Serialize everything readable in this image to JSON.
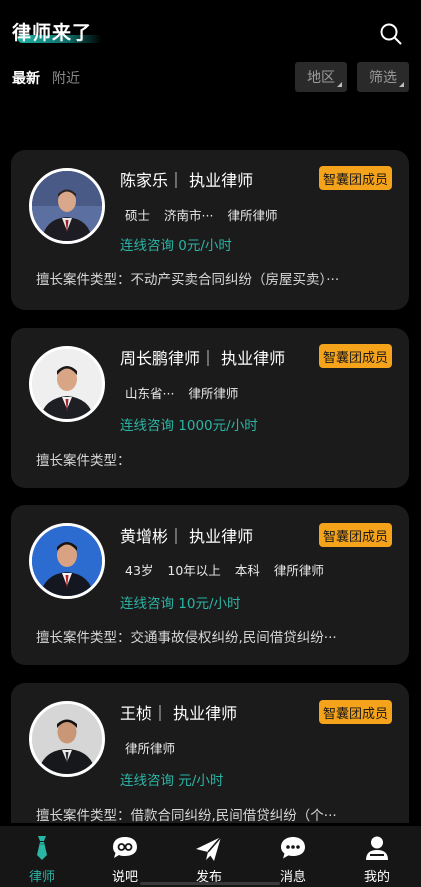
{
  "header": {
    "title": "律师来了"
  },
  "tabs": {
    "latest": "最新",
    "nearby": "附近"
  },
  "filters": {
    "area": "地区",
    "screen": "筛选"
  },
  "colors": {
    "accent": "#2bb5a5",
    "badge": "#f5a31a",
    "card": "#1b1b1b",
    "background": "#000000"
  },
  "lawyers": [
    {
      "name": "陈家乐",
      "title_line": "陈家乐｜ 执业律师",
      "badge": "智囊团成员",
      "meta": [
        "硕士",
        "济南市···",
        "律所律师"
      ],
      "consult": "连线咨询 0元/小时",
      "specialty": "擅长案件类型：不动产买卖合同纠纷（房屋买卖）···"
    },
    {
      "name": "周长鹏律师",
      "title_line": "周长鹏律师｜ 执业律师",
      "badge": "智囊团成员",
      "meta": [
        "山东省···",
        "律所律师"
      ],
      "consult": "连线咨询 1000元/小时",
      "specialty": "擅长案件类型："
    },
    {
      "name": "黄增彬",
      "title_line": "黄增彬｜ 执业律师",
      "badge": "智囊团成员",
      "meta": [
        "43岁",
        "10年以上",
        "本科",
        "律所律师"
      ],
      "consult": "连线咨询 10元/小时",
      "specialty": "擅长案件类型：交通事故侵权纠纷,民间借贷纠纷···"
    },
    {
      "name": "王桢",
      "title_line": "王桢｜ 执业律师",
      "badge": "智囊团成员",
      "meta": [
        "律所律师"
      ],
      "consult": "连线咨询 元/小时",
      "specialty": "擅长案件类型：借款合同纠纷,民间借贷纠纷（个···"
    }
  ],
  "tabbar": [
    {
      "label": "律师",
      "icon": "lawyer-tie-icon",
      "active": true
    },
    {
      "label": "说吧",
      "icon": "chat-bubble-icon",
      "active": false
    },
    {
      "label": "发布",
      "icon": "paper-plane-icon",
      "active": false
    },
    {
      "label": "消息",
      "icon": "message-icon",
      "active": false
    },
    {
      "label": "我的",
      "icon": "user-icon",
      "active": false
    }
  ]
}
